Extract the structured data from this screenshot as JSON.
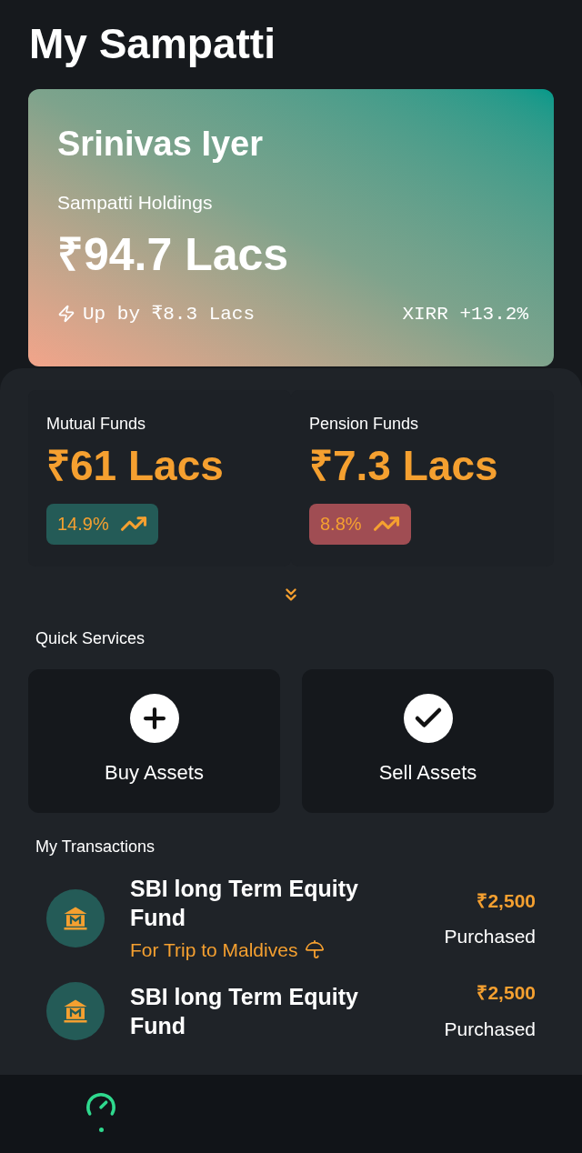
{
  "title": "My Sampatti",
  "holdings_card": {
    "name": "Srinivas Iyer",
    "label": "Sampatti Holdings",
    "amount": "₹94.7 Lacs",
    "change": "Up by ₹8.3 Lacs",
    "xirr": "XIRR +13.2%"
  },
  "funds": [
    {
      "label": "Mutual Funds",
      "amount": "₹61 Lacs",
      "return": "14.9%",
      "color": "#245b57"
    },
    {
      "label": "Pension Funds",
      "amount": "₹7.3 Lacs",
      "return": "8.8%",
      "color": "#a04d53"
    }
  ],
  "quick_services": {
    "title": "Quick Services",
    "buttons": [
      {
        "label": "Buy Assets",
        "kind": "plus"
      },
      {
        "label": "Sell Assets",
        "kind": "check"
      }
    ]
  },
  "transactions": {
    "title": "My Transactions",
    "items": [
      {
        "name": "SBI long Term Equity Fund",
        "note": "For Trip to Maldives",
        "amount": "₹2,500",
        "status": "Purchased"
      },
      {
        "name": "SBI long Term Equity Fund",
        "amount": "₹2,500",
        "status": "Purchased"
      }
    ]
  },
  "bottom_nav": [
    {
      "selected": true
    }
  ]
}
